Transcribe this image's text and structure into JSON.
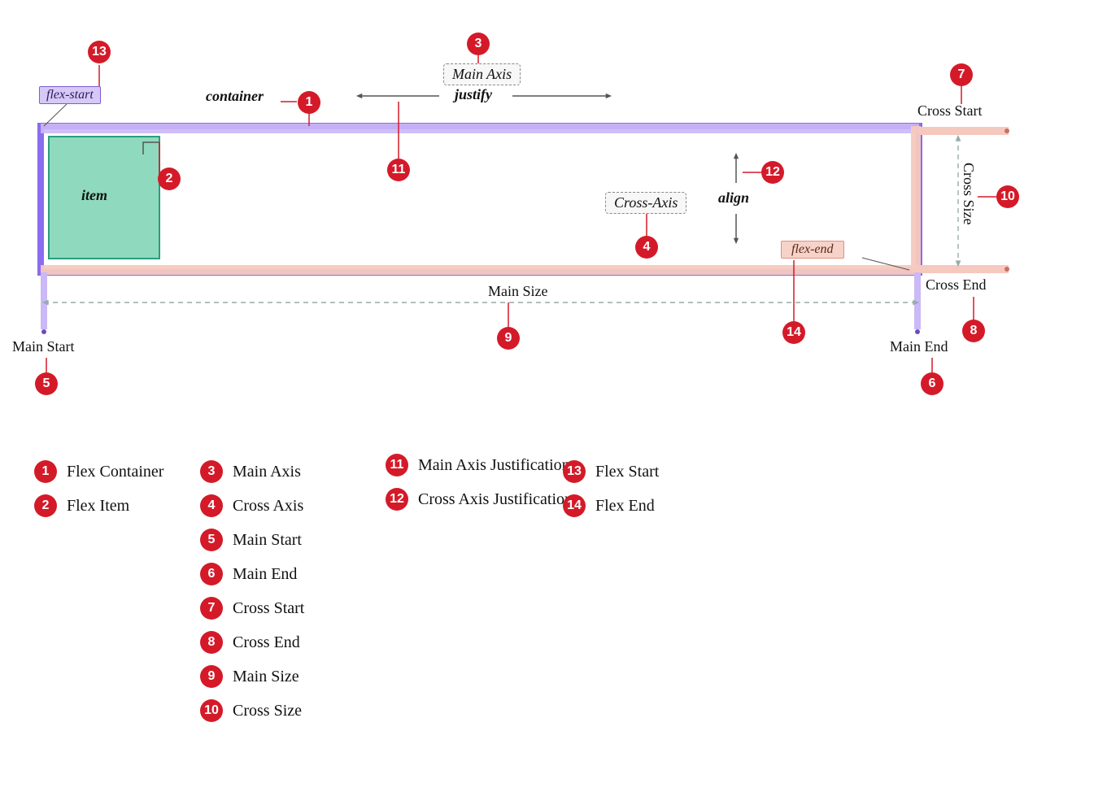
{
  "diagram": {
    "labels": {
      "flex_start": "flex-start",
      "container": "container",
      "main_axis": "Main Axis",
      "justify": "justify",
      "item": "item",
      "cross_axis": "Cross-Axis",
      "align": "align",
      "flex_end": "flex-end",
      "main_size": "Main Size",
      "main_start": "Main Start",
      "main_end": "Main End",
      "cross_start": "Cross Start",
      "cross_end": "Cross End",
      "cross_size": "Cross Size"
    }
  },
  "markers": {
    "n1": "1",
    "n2": "2",
    "n3": "3",
    "n4": "4",
    "n5": "5",
    "n6": "6",
    "n7": "7",
    "n8": "8",
    "n9": "9",
    "n10": "10",
    "n11": "11",
    "n12": "12",
    "n13": "13",
    "n14": "14"
  },
  "legend": {
    "i1": "Flex Container",
    "i2": "Flex Item",
    "i3": "Main Axis",
    "i4": "Cross Axis",
    "i5": "Main Start",
    "i6": "Main End",
    "i7": "Cross Start",
    "i8": "Cross End",
    "i9": "Main Size",
    "i10": "Cross Size",
    "i11": "Main Axis Justification",
    "i12": "Cross Axis Justification",
    "i13": "Flex Start",
    "i14": "Flex End"
  }
}
